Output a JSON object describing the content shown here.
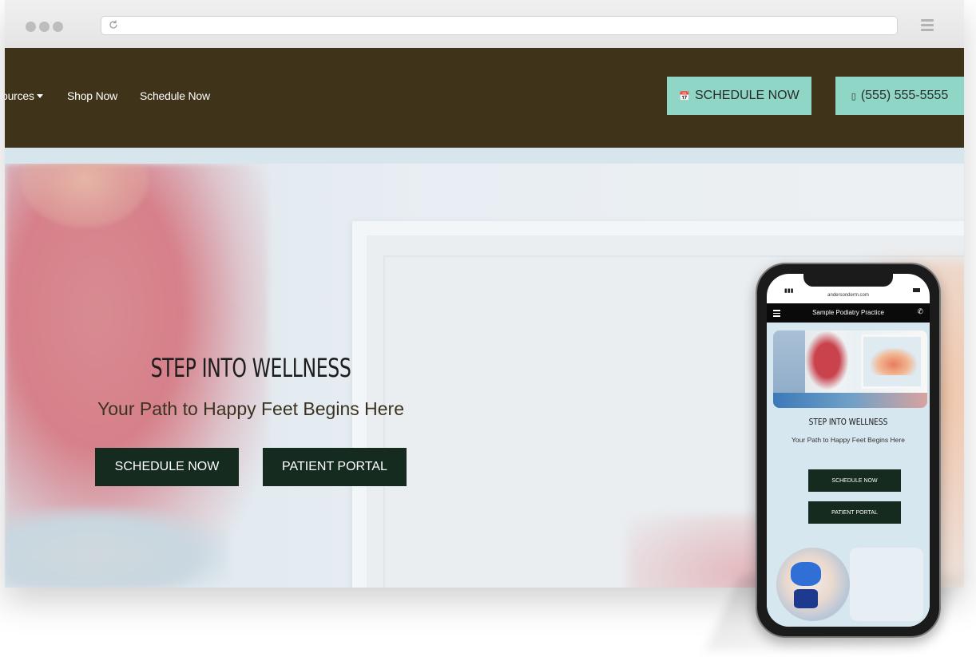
{
  "nav": {
    "resources_label": "ources",
    "shop_label": "Shop Now",
    "schedule_label": "Schedule Now"
  },
  "header_buttons": {
    "schedule_icon": "calendar-icon",
    "schedule_label": "SCHEDULE NOW",
    "phone_icon": "mobile-phone-icon",
    "phone_label": "(555) 555-5555"
  },
  "hero": {
    "title": "STEP INTO WELLNESS",
    "subtitle": "Your Path to Happy Feet Begins Here",
    "schedule_button": "SCHEDULE NOW",
    "portal_button": "PATIENT PORTAL"
  },
  "mobile": {
    "url": "andersonderm.com",
    "title": "Sample Podiatry Practice",
    "hero_title": "STEP INTO WELLNESS",
    "hero_subtitle": "Your Path to Happy Feet Begins Here",
    "schedule_button": "SCHEDULE NOW",
    "portal_button": "PATIENT PORTAL"
  },
  "colors": {
    "header_bg": "#3f331a",
    "accent_button": "#8fd6c6",
    "dark_button": "#152b1f",
    "hero_bg": "#dde6ec"
  }
}
